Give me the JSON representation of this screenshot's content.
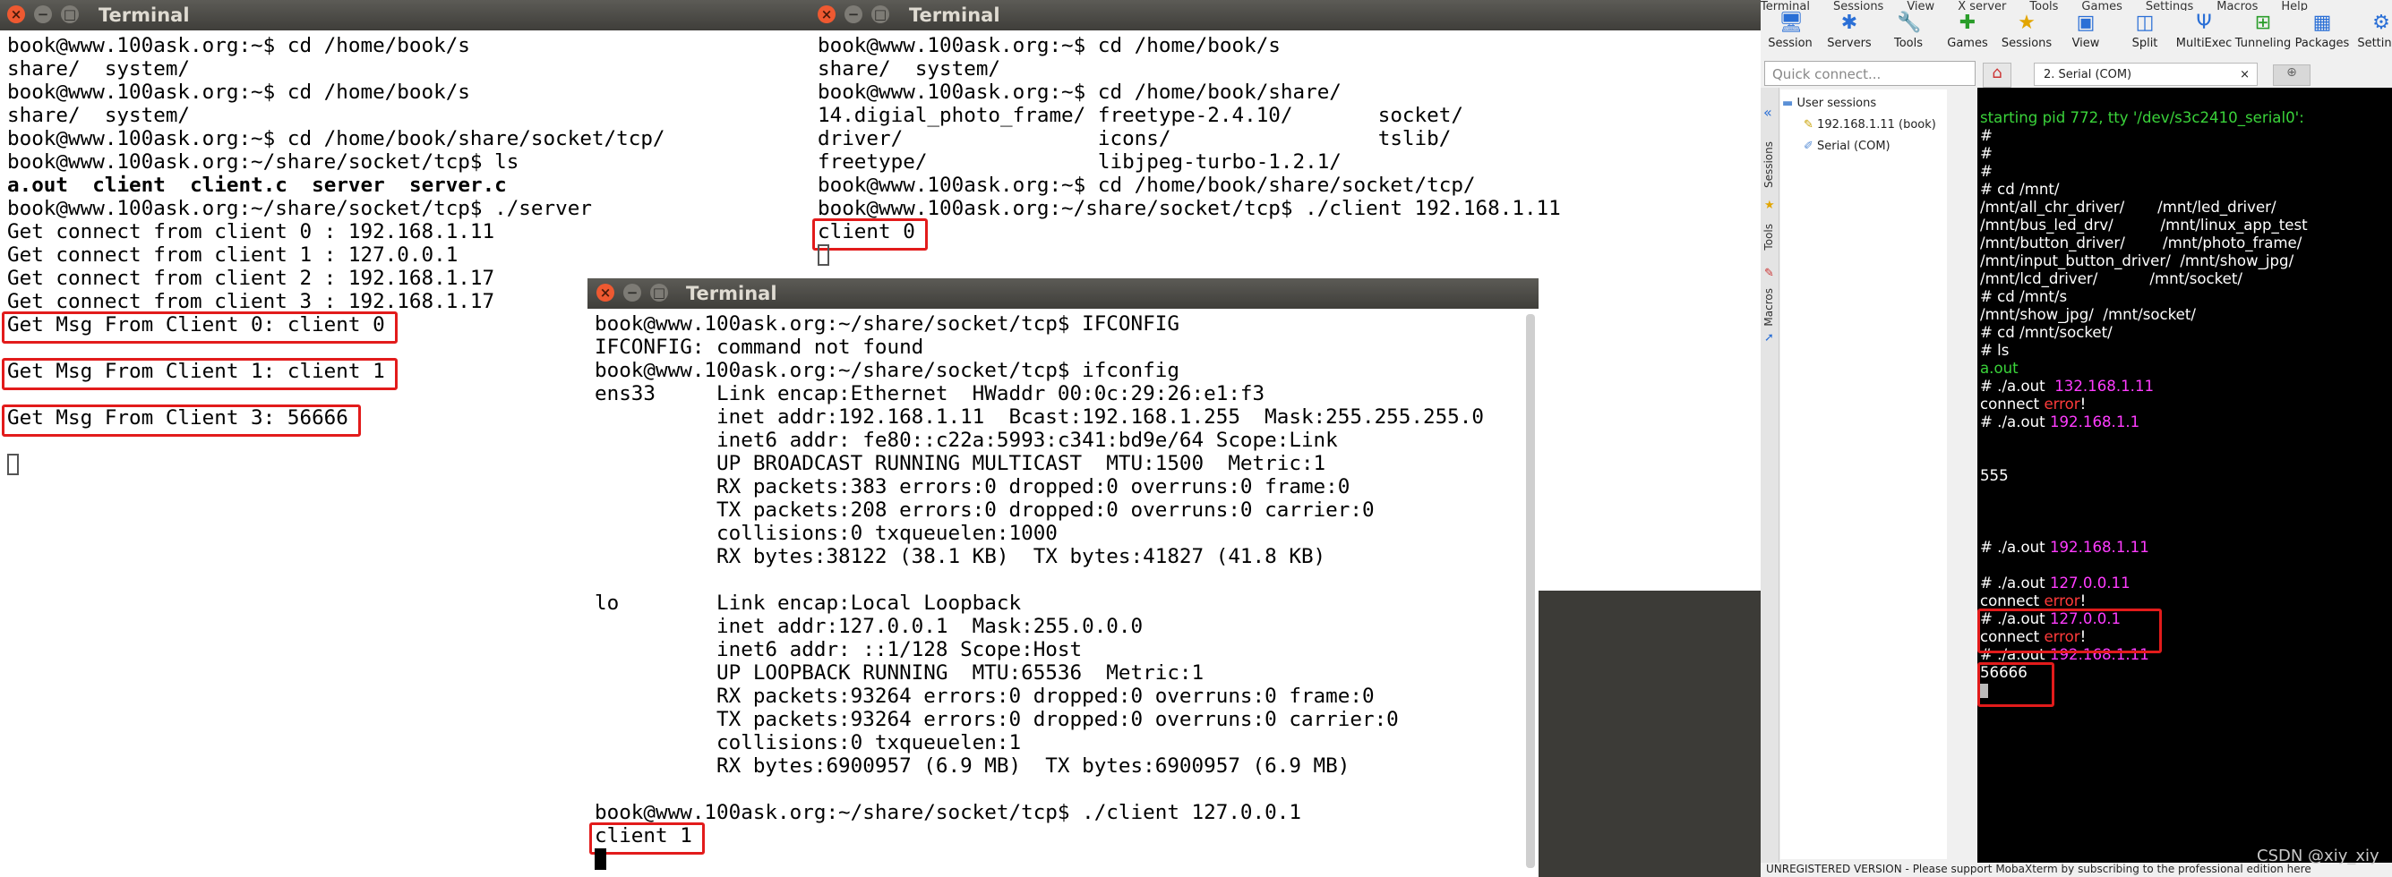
{
  "win1": {
    "title": "Terminal",
    "lines": [
      "book@www.100ask.org:~$ cd /home/book/s",
      "share/  system/",
      "book@www.100ask.org:~$ cd /home/book/s",
      "share/  system/",
      "book@www.100ask.org:~$ cd /home/book/share/socket/tcp/",
      "book@www.100ask.org:~/share/socket/tcp$ ls",
      "__LS__",
      "book@www.100ask.org:~/share/socket/tcp$ ./server",
      "Get connect from client 0 : 192.168.1.11",
      "Get connect from client 1 : 127.0.0.1",
      "Get connect from client 2 : 192.168.1.17",
      "Get connect from client 3 : 192.168.1.17",
      "Get Msg From Client 0: client 0",
      "",
      "Get Msg From Client 1: client 1",
      "",
      "Get Msg From Client 3: 56666"
    ],
    "ls_items": [
      "a.out",
      "client",
      "client.c",
      "server",
      "server.c"
    ]
  },
  "win2": {
    "title": "Terminal",
    "lines": [
      "book@www.100ask.org:~$ cd /home/book/s",
      "share/  system/",
      "book@www.100ask.org:~$ cd /home/book/share/",
      "14.digial_photo_frame/ freetype-2.4.10/       socket/",
      "driver/                icons/                 tslib/",
      "freetype/              libjpeg-turbo-1.2.1/",
      "book@www.100ask.org:~$ cd /home/book/share/socket/tcp/",
      "book@www.100ask.org:~/share/socket/tcp$ ./client 192.168.1.11",
      "client 0"
    ]
  },
  "win3": {
    "title": "Terminal",
    "lines": [
      "book@www.100ask.org:~/share/socket/tcp$ IFCONFIG",
      "IFCONFIG: command not found",
      "book@www.100ask.org:~/share/socket/tcp$ ifconfig",
      "ens33     Link encap:Ethernet  HWaddr 00:0c:29:26:e1:f3",
      "          inet addr:192.168.1.11  Bcast:192.168.1.255  Mask:255.255.255.0",
      "          inet6 addr: fe80::c22a:5993:c341:bd9e/64 Scope:Link",
      "          UP BROADCAST RUNNING MULTICAST  MTU:1500  Metric:1",
      "          RX packets:383 errors:0 dropped:0 overruns:0 frame:0",
      "          TX packets:208 errors:0 dropped:0 overruns:0 carrier:0",
      "          collisions:0 txqueuelen:1000",
      "          RX bytes:38122 (38.1 KB)  TX bytes:41827 (41.8 KB)",
      "",
      "lo        Link encap:Local Loopback",
      "          inet addr:127.0.0.1  Mask:255.0.0.0",
      "          inet6 addr: ::1/128 Scope:Host",
      "          UP LOOPBACK RUNNING  MTU:65536  Metric:1",
      "          RX packets:93264 errors:0 dropped:0 overruns:0 frame:0",
      "          TX packets:93264 errors:0 dropped:0 overruns:0 carrier:0",
      "          collisions:0 txqueuelen:1",
      "          RX bytes:6900957 (6.9 MB)  TX bytes:6900957 (6.9 MB)",
      "",
      "book@www.100ask.org:~/share/socket/tcp$ ./client 127.0.0.1",
      "client 1"
    ]
  },
  "moba": {
    "menu": [
      "Terminal",
      "Sessions",
      "View",
      "X server",
      "Tools",
      "Games",
      "Settings",
      "Macros",
      "Help"
    ],
    "tools": [
      {
        "label": "Session",
        "icon": "session-icon",
        "glyph": "🖥"
      },
      {
        "label": "Servers",
        "icon": "servers-icon",
        "glyph": "✱"
      },
      {
        "label": "Tools",
        "icon": "tools-icon",
        "glyph": "🔧"
      },
      {
        "label": "Games",
        "icon": "games-icon",
        "glyph": "✚"
      },
      {
        "label": "Sessions",
        "icon": "sessions-star-icon",
        "glyph": "★"
      },
      {
        "label": "View",
        "icon": "view-icon",
        "glyph": "▣"
      },
      {
        "label": "Split",
        "icon": "split-icon",
        "glyph": "◫"
      },
      {
        "label": "MultiExec",
        "icon": "multiexec-icon",
        "glyph": "Ψ"
      },
      {
        "label": "Tunneling",
        "icon": "tunneling-icon",
        "glyph": "⊞"
      },
      {
        "label": "Packages",
        "icon": "packages-icon",
        "glyph": "▦"
      },
      {
        "label": "Settings",
        "icon": "settings-icon",
        "glyph": "⚙"
      }
    ],
    "quick_connect_placeholder": "Quick connect...",
    "serial_tab": "2. Serial (COM)",
    "side_labels": [
      "Sessions",
      "Tools",
      "Macros"
    ],
    "user_sessions": "User sessions",
    "session_items": [
      "192.168.1.11 (book)",
      "Serial (COM)"
    ],
    "status": "UNREGISTERED VERSION  -  Please support MobaXterm by subscribing to the professional edition here",
    "colors": {
      "green": "#3ad33a",
      "magenta": "#ff3cff",
      "red": "#ff3b3b"
    }
  },
  "mterm_lines": [
    [
      [
        "starting pid 772, tty '/dev/s3c2410_serial0':",
        "g"
      ]
    ],
    [
      [
        "#",
        "w"
      ]
    ],
    [
      [
        "#",
        "w"
      ]
    ],
    [
      [
        "#",
        "w"
      ]
    ],
    [
      [
        "# cd /mnt/",
        "w"
      ]
    ],
    [
      [
        "/mnt/all_chr_driver/       /mnt/led_driver/",
        "w"
      ]
    ],
    [
      [
        "/mnt/bus_led_drv/          /mnt/linux_app_test",
        "w"
      ]
    ],
    [
      [
        "/mnt/button_driver/        /mnt/photo_frame/",
        "w"
      ]
    ],
    [
      [
        "/mnt/input_button_driver/  /mnt/show_jpg/",
        "w"
      ]
    ],
    [
      [
        "/mnt/lcd_driver/           /mnt/socket/",
        "w"
      ]
    ],
    [
      [
        "# cd /mnt/s",
        "w"
      ]
    ],
    [
      [
        "/mnt/show_jpg/  /mnt/socket/",
        "w"
      ]
    ],
    [
      [
        "# cd /mnt/socket/",
        "w"
      ]
    ],
    [
      [
        "# ls",
        "w"
      ]
    ],
    [
      [
        "a.out",
        "g"
      ]
    ],
    [
      [
        "# ./a.out  ",
        "w"
      ],
      [
        "132.168.1.11",
        "p"
      ]
    ],
    [
      [
        "connect ",
        "w"
      ],
      [
        "error",
        "r"
      ],
      [
        "!",
        "w"
      ]
    ],
    [
      [
        "# ./a.out ",
        "w"
      ],
      [
        "192.168.1.1",
        "p"
      ]
    ],
    [
      [
        "",
        "w"
      ]
    ],
    [
      [
        "",
        "w"
      ]
    ],
    [
      [
        "555",
        "w"
      ]
    ],
    [
      [
        "",
        "w"
      ]
    ],
    [
      [
        "",
        "w"
      ]
    ],
    [
      [
        "",
        "w"
      ]
    ],
    [
      [
        "# ./a.out ",
        "w"
      ],
      [
        "192.168.1.11",
        "p"
      ]
    ],
    [
      [
        "",
        "w"
      ]
    ],
    [
      [
        "# ./a.out ",
        "w"
      ],
      [
        "127.0.0.11",
        "p"
      ]
    ],
    [
      [
        "connect ",
        "w"
      ],
      [
        "error",
        "r"
      ],
      [
        "!",
        "w"
      ]
    ],
    [
      [
        "# ./a.out ",
        "w"
      ],
      [
        "127.0.0.1",
        "p"
      ]
    ],
    [
      [
        "connect ",
        "w"
      ],
      [
        "error",
        "r"
      ],
      [
        "!",
        "w"
      ]
    ],
    [
      [
        "# ./a.out ",
        "w"
      ],
      [
        "192.168.1.11",
        "p"
      ]
    ],
    [
      [
        "56666",
        "w"
      ]
    ]
  ],
  "watermark": "CSDN @xiy_xiy"
}
